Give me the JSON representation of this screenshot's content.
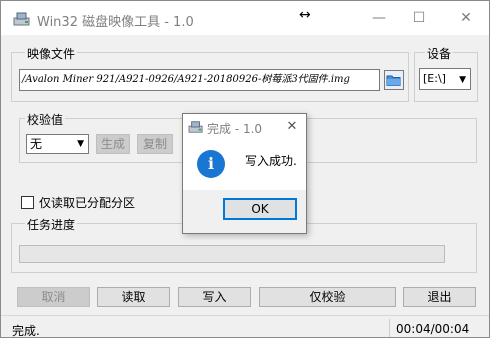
{
  "window": {
    "title": "Win32 磁盘映像工具 - 1.0"
  },
  "image_file": {
    "label": "映像文件",
    "path": "/Avalon Miner 921/A921-0926/A921-20180926-树莓派3代固件.img"
  },
  "device": {
    "label": "设备",
    "value": "[E:\\]"
  },
  "hash": {
    "label": "校验值",
    "type_value": "无",
    "generate": "生成",
    "copy": "复制"
  },
  "read_only": {
    "label": "仅读取已分配分区",
    "checked": false
  },
  "progress": {
    "label": "任务进度",
    "value": 0
  },
  "buttons": {
    "cancel": "取消",
    "read": "读取",
    "write": "写入",
    "verify_only": "仅校验",
    "exit": "退出"
  },
  "status": {
    "text": "完成.",
    "time": "00:04/00:04"
  },
  "dialog": {
    "title": "完成 - 1.0",
    "message": "写入成功.",
    "ok": "OK"
  },
  "colors": {
    "accent": "#0078d7",
    "info_icon": "#1976d2"
  }
}
